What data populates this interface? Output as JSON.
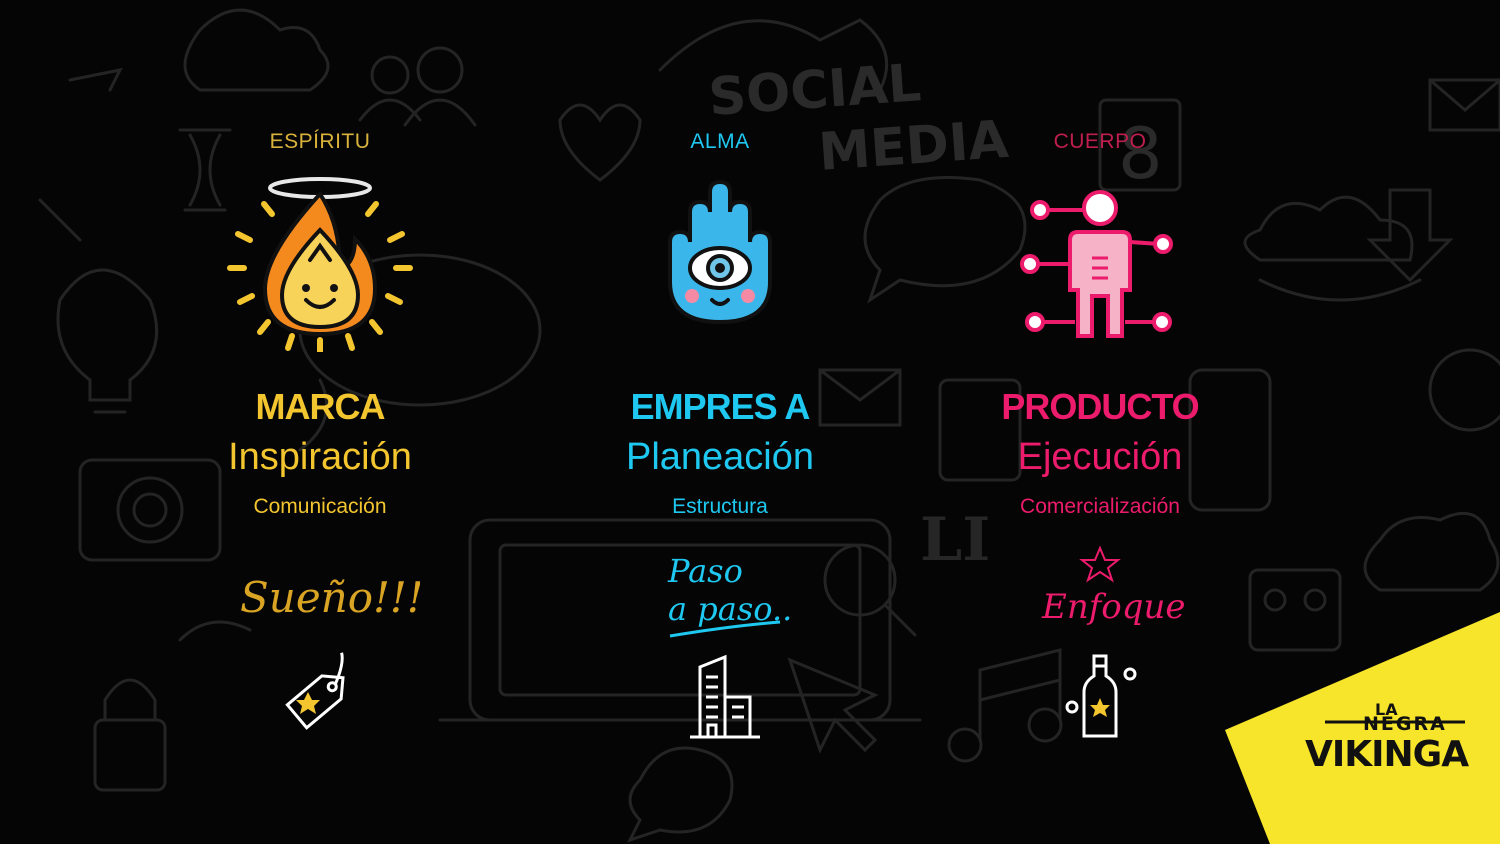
{
  "colors": {
    "yellow": "#f3c52f",
    "cyan": "#1ec8f0",
    "pink": "#ec1b6b",
    "background": "#050505",
    "logo_bg": "#f6e52a"
  },
  "columns": [
    {
      "top_label": "ESPÍRITU",
      "title": "MARCA",
      "subtitle": "Inspiración",
      "detail": "Comunicación",
      "script": "Sueño!!!",
      "icon": "fire-spirit-icon",
      "small_icon": "price-tag-icon",
      "color": "#f3c52f"
    },
    {
      "top_label": "ALMA",
      "title": "EMPRES A",
      "subtitle": "Planeación",
      "detail": "Estructura",
      "script_line1": "Paso",
      "script_line2": "a paso..",
      "icon": "hamsa-hand-icon",
      "small_icon": "buildings-icon",
      "color": "#1ec8f0"
    },
    {
      "top_label": "CUERPO",
      "title": "PRODUCTO",
      "subtitle": "Ejecución",
      "detail": "Comercialización",
      "script": "Enfoque",
      "icon": "body-diagram-icon",
      "small_icon": "bottle-icon",
      "color": "#ec1b6b"
    }
  ],
  "logo": {
    "line1": "LA",
    "line2": "NEGRA",
    "line3": "VIKINGA"
  }
}
